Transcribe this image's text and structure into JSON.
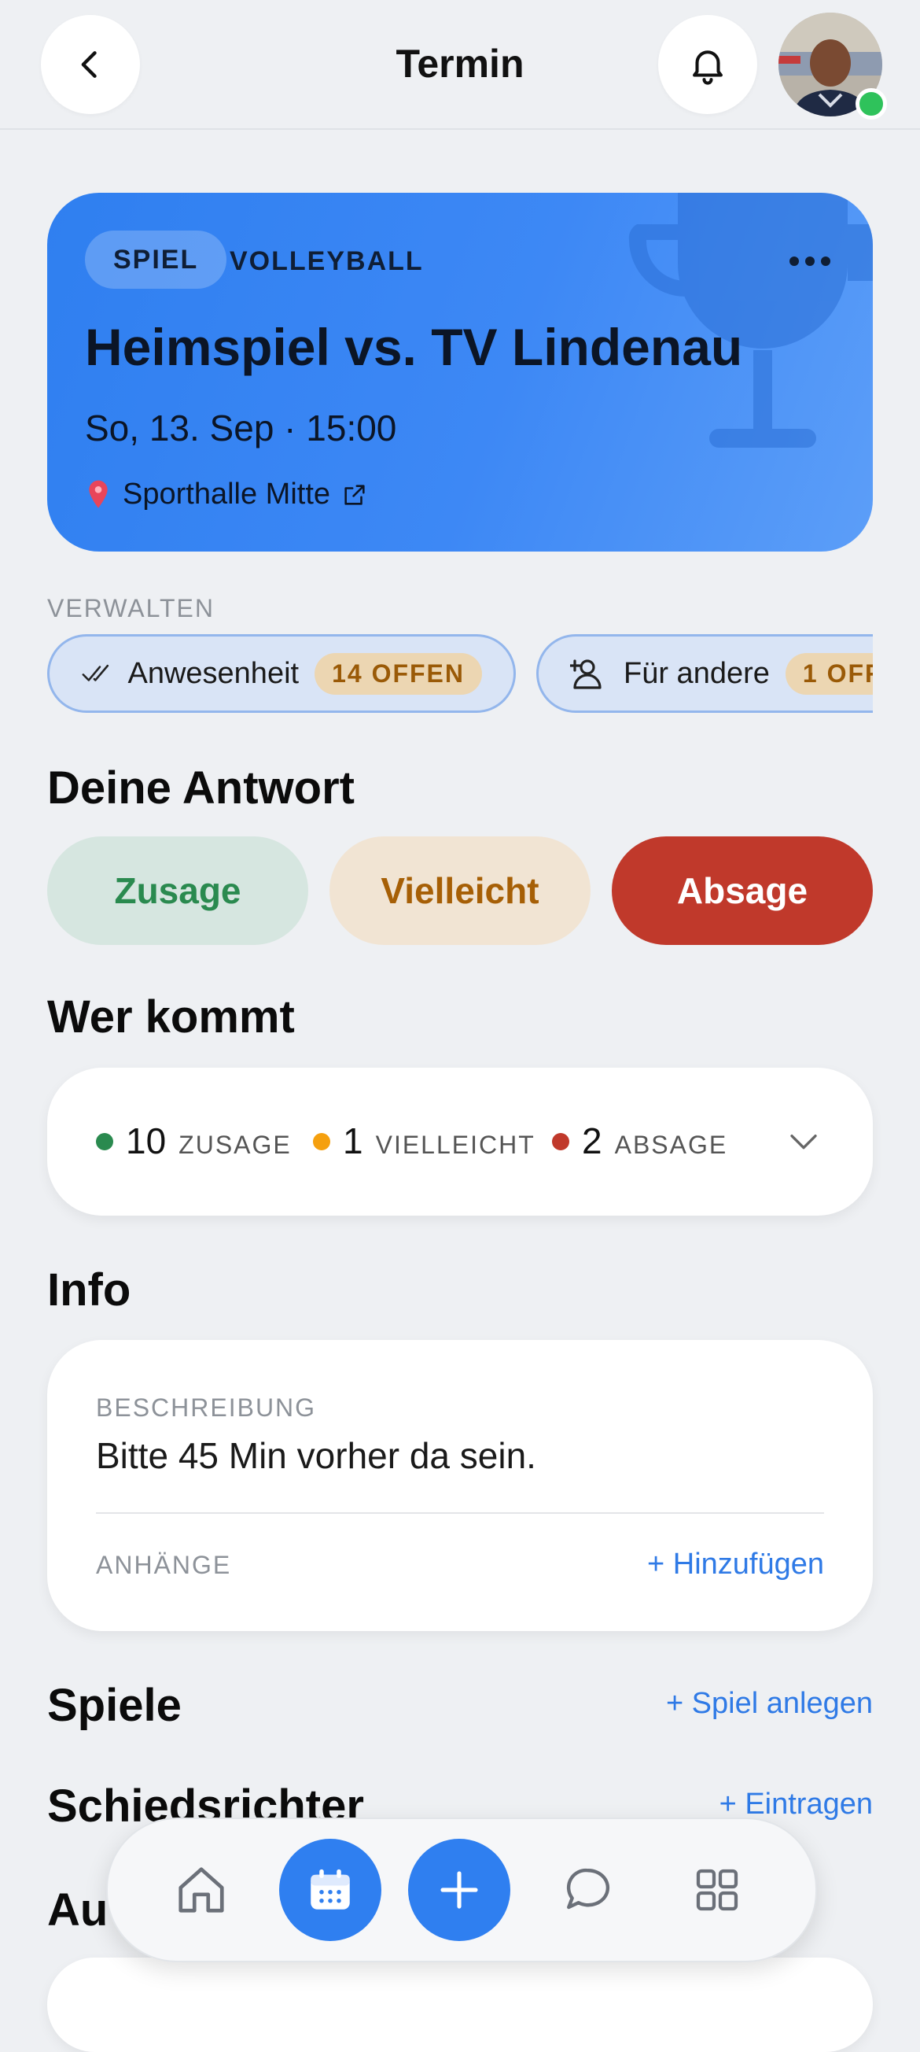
{
  "header": {
    "title": "Termin",
    "back_icon": "chevron-left-icon",
    "bell_icon": "bell-icon"
  },
  "event": {
    "type_label": "SPIEL",
    "sport_label": "VOLLEYBALL",
    "title": "Heimspiel vs. TV Lindenau",
    "date": "So, 13. Sep · 15:00",
    "location": "Sporthalle Mitte",
    "colors": {
      "card": "#3d88f5"
    }
  },
  "manage": {
    "label": "VERWALTEN",
    "chips": [
      {
        "label": "Anwesenheit",
        "badge": "14 OFFEN"
      },
      {
        "label": "Für andere",
        "badge": "1 OFF"
      }
    ]
  },
  "response": {
    "heading": "Deine Antwort",
    "yes": "Zusage",
    "maybe": "Vielleicht",
    "no": "Absage",
    "colors": {
      "yes": "#2a8a4f",
      "maybe": "#a65f06",
      "no": "#c0392b"
    }
  },
  "attendance": {
    "heading": "Wer kommt",
    "yes_count": "10",
    "yes_label": "ZUSAGE",
    "maybe_count": "1",
    "maybe_label": "VIELLEICHT",
    "no_count": "2",
    "no_label": "ABSAGE"
  },
  "info": {
    "heading": "Info",
    "description_label": "BESCHREIBUNG",
    "description": "Bitte 45 Min vorher da sein.",
    "attachments_label": "ANHÄNGE",
    "add_link": "+ Hinzufügen"
  },
  "games": {
    "heading": "Spiele",
    "action": "+ Spiel anlegen"
  },
  "referees": {
    "heading": "Schiedsrichter",
    "action": "+ Eintragen"
  },
  "partial_heading": "Au",
  "nav": {
    "items": [
      "home-icon",
      "calendar-icon",
      "plus-icon",
      "chat-icon",
      "grid-icon"
    ],
    "active": "calendar-icon"
  }
}
